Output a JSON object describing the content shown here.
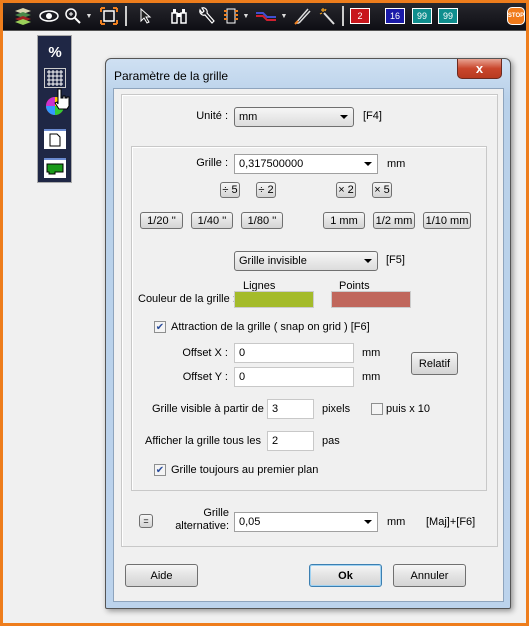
{
  "toolbar": {
    "icons": [
      "layers-icon",
      "eye-icon",
      "zoom-icon",
      "dropdown-arrow-icon",
      "fit-view-icon",
      "pointer-icon",
      "binoculars-icon",
      "wrench-icon",
      "component-icon",
      "dropdown-arrow-icon",
      "traces-icon",
      "dropdown-arrow-icon",
      "pen-icon",
      "magic-wand-icon"
    ],
    "badges": [
      {
        "label": "2",
        "color": "#c8161c"
      },
      {
        "label": "16",
        "color": "#1a1aa8"
      },
      {
        "label": "99",
        "color": "#0f8e8e"
      },
      {
        "label": "99",
        "color": "#0f8e8e"
      }
    ],
    "stop_label": "STOP"
  },
  "palette": {
    "percent_label": "%",
    "items": [
      "grid-icon",
      "color-wheel-icon",
      "page-icon",
      "board-icon"
    ]
  },
  "dialog": {
    "title": "Paramètre de la grille",
    "close_label": "x",
    "unit": {
      "label": "Unité :",
      "value": "mm",
      "shortcut": "[F4]"
    },
    "grid": {
      "label": "Grille :",
      "value": "0,317500000",
      "unit": "mm"
    },
    "scale_buttons": [
      "÷ 5",
      "÷ 2",
      "× 2",
      "× 5"
    ],
    "preset_buttons": [
      "1/20 ''",
      "1/40 ''",
      "1/80 ''",
      "1 mm",
      "1/2 mm",
      "1/10 mm"
    ],
    "display_mode": {
      "value": "Grille invisible",
      "shortcut": "[F5]"
    },
    "color": {
      "label": "Couleur de la grille :",
      "lines_label": "Lignes",
      "points_label": "Points",
      "lines_color": "#a4bb2a",
      "points_color": "#c0675c"
    },
    "snap": {
      "label": "Attraction de la grille ( snap on grid )  [F6]",
      "checked": true
    },
    "offset_x": {
      "label": "Offset X :",
      "value": "0",
      "unit": "mm"
    },
    "offset_y": {
      "label": "Offset Y :",
      "value": "0",
      "unit": "mm"
    },
    "relative_label": "Relatif",
    "visible_from": {
      "label": "Grille visible à partir de",
      "value": "3",
      "unit": "pixels"
    },
    "times10": {
      "label": "puis x 10",
      "checked": false
    },
    "show_every": {
      "label": "Afficher la grille tous les",
      "value": "2",
      "unit": "pas"
    },
    "foreground": {
      "label": "Grille toujours au premier plan",
      "checked": true
    },
    "alt_grid": {
      "equal_label": "=",
      "label_line1": "Grille",
      "label_line2": "alternative:",
      "value": "0,05",
      "unit": "mm",
      "shortcut": "[Maj]+[F6]"
    },
    "help_label": "Aide",
    "ok_label": "Ok",
    "cancel_label": "Annuler"
  }
}
